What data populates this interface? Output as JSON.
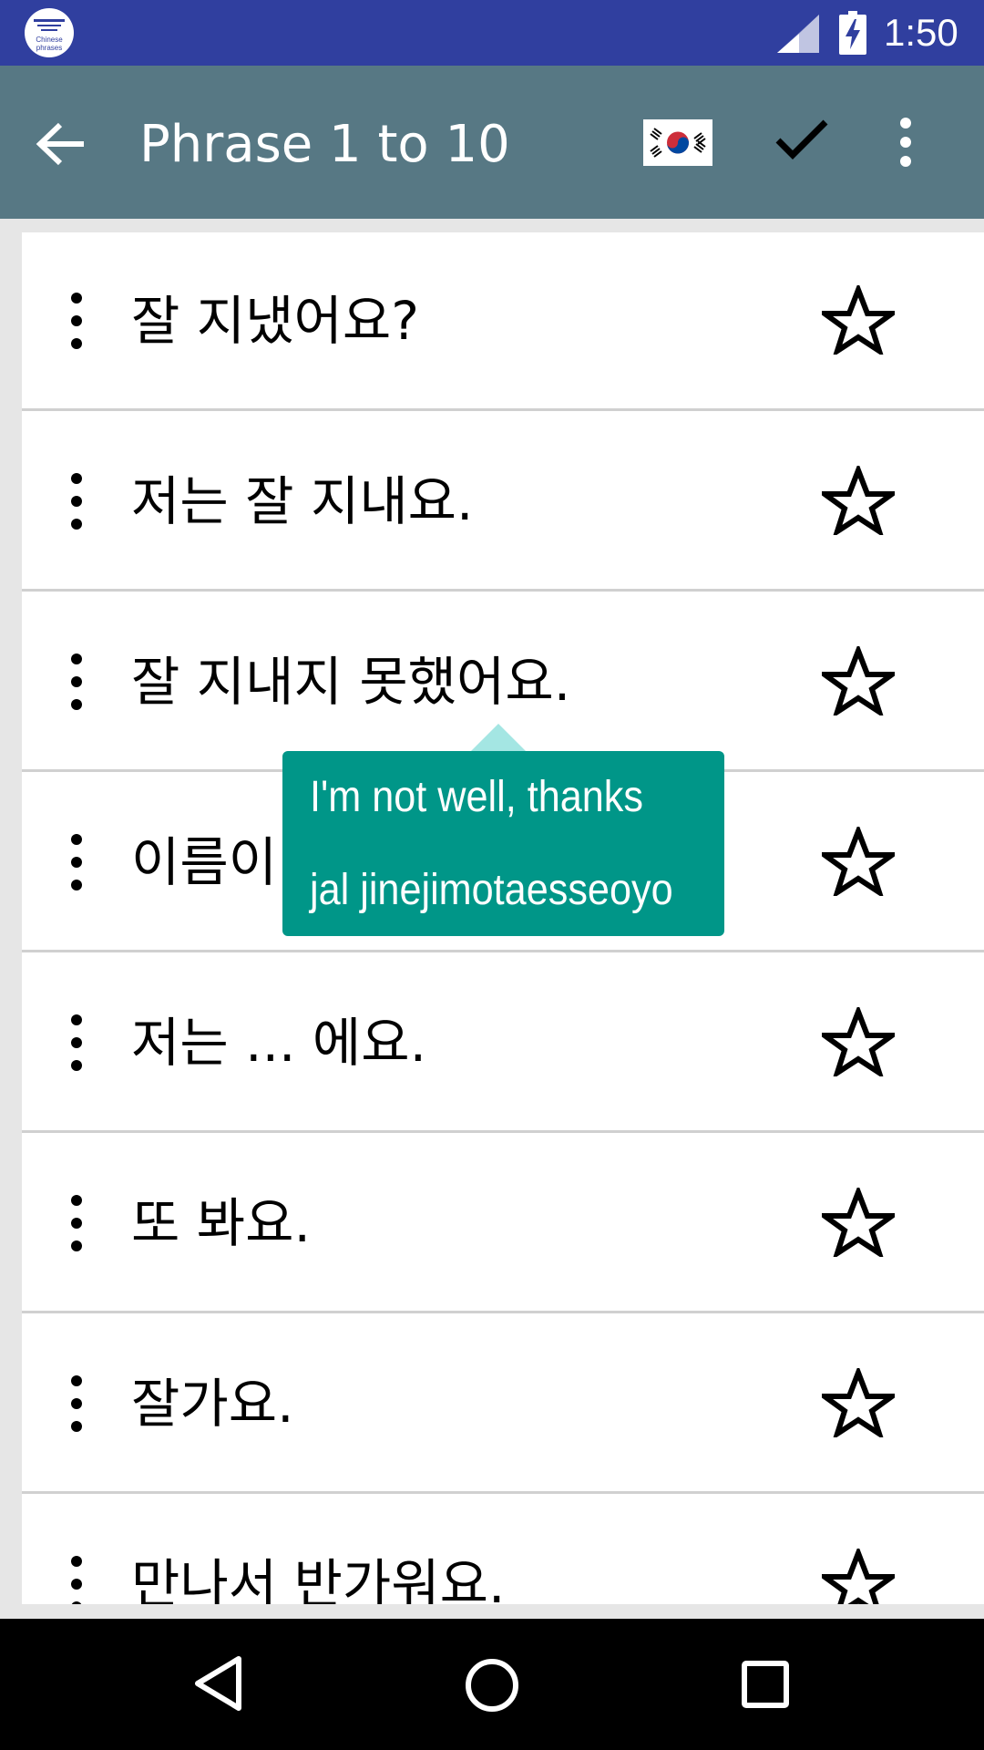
{
  "status_bar": {
    "time": "1:50",
    "app_logo_text": "Chinese phrases",
    "signal_icon": "cell-signal-icon",
    "battery_icon": "battery-charging-icon"
  },
  "toolbar": {
    "title": "Phrase 1 to 10",
    "back_icon": "arrow-back-icon",
    "flag_icon": "south-korea-flag-icon",
    "check_icon": "check-icon",
    "overflow_icon": "more-vert-icon"
  },
  "phrases": [
    {
      "text": "잘 지냈어요?",
      "starred": false
    },
    {
      "text": "저는 잘 지내요.",
      "starred": false
    },
    {
      "text": "잘 지내지 못했어요.",
      "starred": false
    },
    {
      "text": "이름이",
      "starred": false
    },
    {
      "text": "저는 ... 에요.",
      "starred": false
    },
    {
      "text": "또 봐요.",
      "starred": false
    },
    {
      "text": "잘가요.",
      "starred": false
    },
    {
      "text": "만나서 반가워요.",
      "starred": false
    }
  ],
  "tooltip": {
    "translation": "I'm not well, thanks",
    "romanization": "jal jinejimotaesseoyo"
  },
  "colors": {
    "status_bar": "#303f9f",
    "app_bar": "#577884",
    "tooltip": "#009688",
    "tooltip_arrow": "#a4e6e3"
  },
  "nav_bar": {
    "back_icon": "nav-back-icon",
    "home_icon": "nav-home-icon",
    "recents_icon": "nav-recents-icon"
  }
}
